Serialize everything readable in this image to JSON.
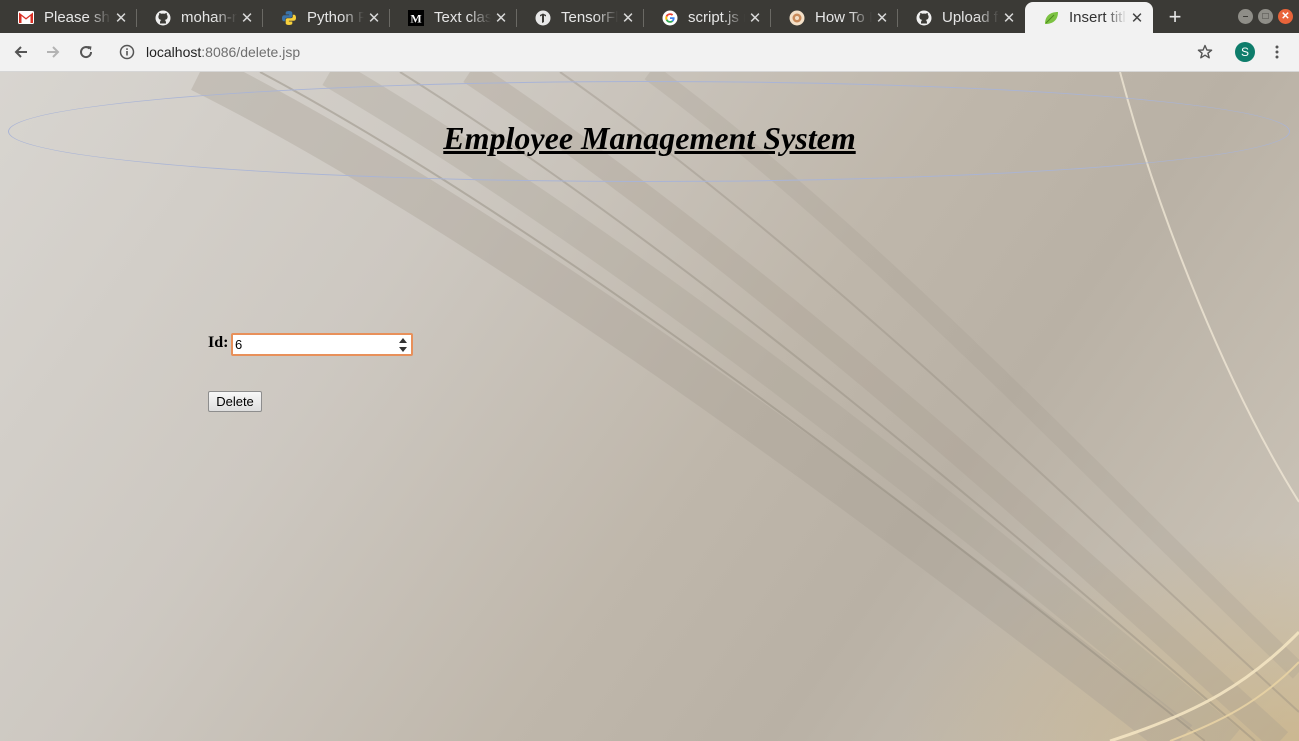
{
  "browser": {
    "tabs": [
      {
        "title": "Please sh",
        "icon": "gmail-icon"
      },
      {
        "title": "mohan-m",
        "icon": "github-icon"
      },
      {
        "title": "Python P",
        "icon": "python-icon"
      },
      {
        "title": "Text class",
        "icon": "medium-icon"
      },
      {
        "title": "TensorFlo",
        "icon": "tensorflow-icon"
      },
      {
        "title": "script.js r",
        "icon": "google-icon"
      },
      {
        "title": "How To In",
        "icon": "site-icon"
      },
      {
        "title": "Upload fil",
        "icon": "github-icon"
      },
      {
        "title": "Insert titl",
        "icon": "leaf-icon",
        "active": true
      }
    ],
    "new_tab": "+",
    "url_host": "localhost",
    "url_rest": ":8086/delete.jsp",
    "profile_initial": "S",
    "colors": {
      "tabstrip": "#3b3a36",
      "toolbar": "#f2f2f2",
      "profile": "#0e7d6b"
    }
  },
  "page": {
    "title": "Employee Management System",
    "form": {
      "id_label": "Id:",
      "id_value": "6",
      "delete_label": "Delete"
    },
    "colors": {
      "ellipse_border": "#a9b4d6",
      "input_focus_border": "#e8905a"
    }
  }
}
